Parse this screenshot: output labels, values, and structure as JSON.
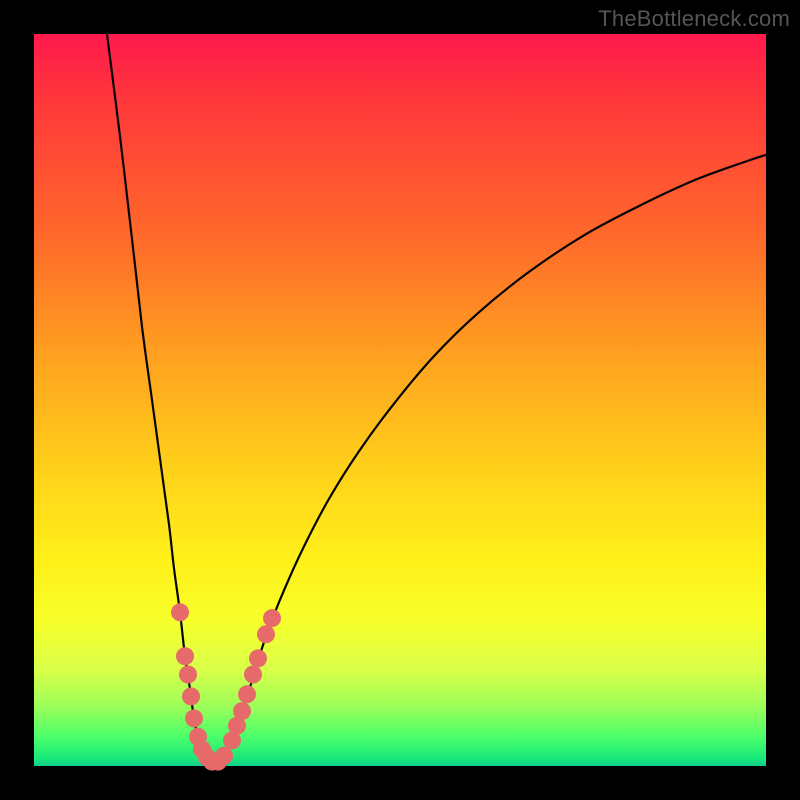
{
  "watermark": {
    "text": "TheBottleneck.com"
  },
  "colors": {
    "frame": "#000000",
    "curve": "#050505",
    "marker_fill": "#e66a6a",
    "marker_stroke": "#cc5a5a"
  },
  "chart_data": {
    "type": "line",
    "title": "",
    "xlabel": "",
    "ylabel": "",
    "x_range": [
      0,
      732
    ],
    "y_range_percent": [
      0,
      100
    ],
    "left_curve_points": [
      {
        "x": 73,
        "y_pct": 100.0
      },
      {
        "x": 86,
        "y_pct": 86.0
      },
      {
        "x": 98,
        "y_pct": 72.0
      },
      {
        "x": 108,
        "y_pct": 60.0
      },
      {
        "x": 118,
        "y_pct": 50.0
      },
      {
        "x": 127,
        "y_pct": 41.0
      },
      {
        "x": 135,
        "y_pct": 33.0
      },
      {
        "x": 140,
        "y_pct": 27.0
      },
      {
        "x": 146,
        "y_pct": 21.0
      },
      {
        "x": 151,
        "y_pct": 15.0
      },
      {
        "x": 156,
        "y_pct": 10.5
      },
      {
        "x": 160,
        "y_pct": 6.5
      },
      {
        "x": 165,
        "y_pct": 3.5
      },
      {
        "x": 172,
        "y_pct": 1.2
      },
      {
        "x": 180,
        "y_pct": 0.5
      }
    ],
    "right_curve_points": [
      {
        "x": 180,
        "y_pct": 0.5
      },
      {
        "x": 190,
        "y_pct": 1.4
      },
      {
        "x": 200,
        "y_pct": 4.0
      },
      {
        "x": 210,
        "y_pct": 8.0
      },
      {
        "x": 222,
        "y_pct": 13.5
      },
      {
        "x": 234,
        "y_pct": 18.5
      },
      {
        "x": 250,
        "y_pct": 24.0
      },
      {
        "x": 270,
        "y_pct": 30.0
      },
      {
        "x": 295,
        "y_pct": 36.5
      },
      {
        "x": 325,
        "y_pct": 43.0
      },
      {
        "x": 360,
        "y_pct": 49.5
      },
      {
        "x": 400,
        "y_pct": 56.0
      },
      {
        "x": 445,
        "y_pct": 62.0
      },
      {
        "x": 495,
        "y_pct": 67.5
      },
      {
        "x": 550,
        "y_pct": 72.5
      },
      {
        "x": 605,
        "y_pct": 76.5
      },
      {
        "x": 660,
        "y_pct": 80.0
      },
      {
        "x": 710,
        "y_pct": 82.5
      },
      {
        "x": 732,
        "y_pct": 83.5
      }
    ],
    "markers_left": [
      {
        "x": 146,
        "y_pct": 21.0
      },
      {
        "x": 151,
        "y_pct": 15.0
      },
      {
        "x": 154,
        "y_pct": 12.5
      },
      {
        "x": 157,
        "y_pct": 9.5
      },
      {
        "x": 160,
        "y_pct": 6.5
      },
      {
        "x": 164,
        "y_pct": 4.0
      },
      {
        "x": 168,
        "y_pct": 2.3
      },
      {
        "x": 173,
        "y_pct": 1.2
      }
    ],
    "markers_bottom": [
      {
        "x": 178,
        "y_pct": 0.6
      },
      {
        "x": 184,
        "y_pct": 0.6
      },
      {
        "x": 190,
        "y_pct": 1.4
      }
    ],
    "markers_right": [
      {
        "x": 198,
        "y_pct": 3.5
      },
      {
        "x": 203,
        "y_pct": 5.5
      },
      {
        "x": 208,
        "y_pct": 7.5
      },
      {
        "x": 213,
        "y_pct": 9.8
      },
      {
        "x": 219,
        "y_pct": 12.5
      },
      {
        "x": 224,
        "y_pct": 14.7
      },
      {
        "x": 232,
        "y_pct": 18.0
      },
      {
        "x": 238,
        "y_pct": 20.2
      }
    ],
    "marker_radius": 9
  }
}
